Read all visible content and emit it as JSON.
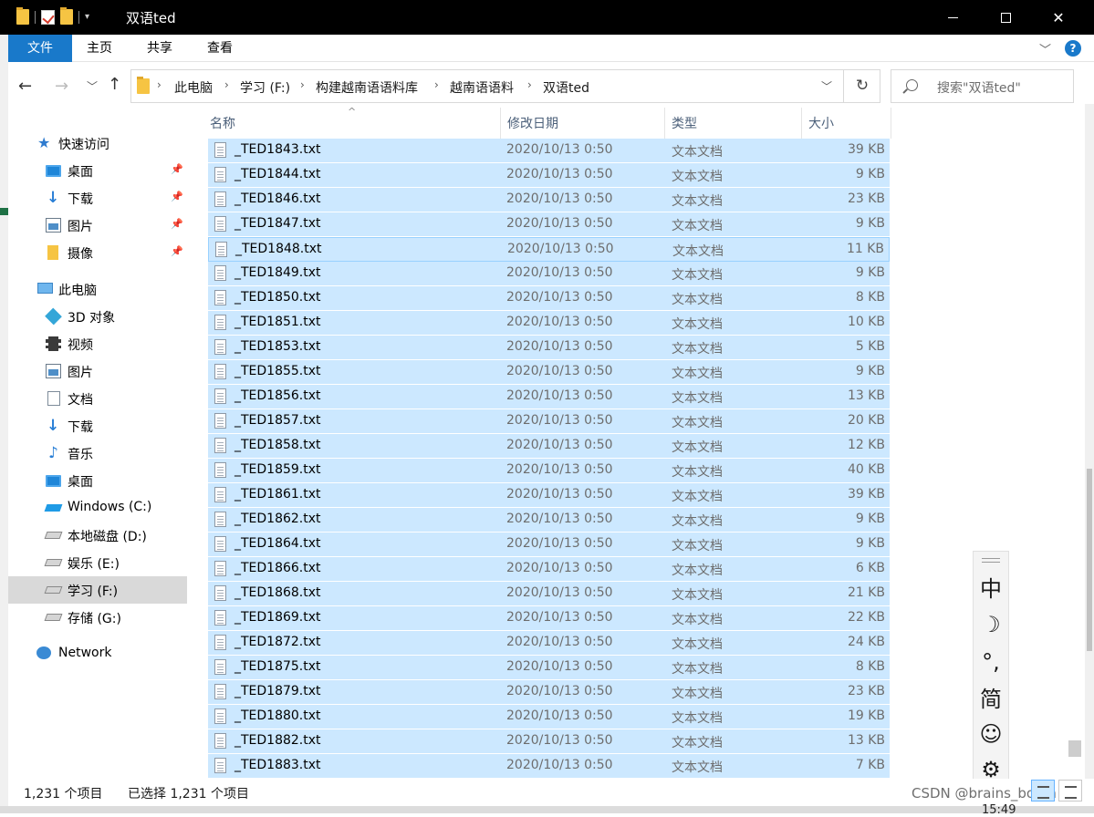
{
  "window": {
    "title": "双语ted",
    "minimize_glyph": "minimize-icon",
    "maximize_glyph": "maximize-icon",
    "close_glyph": "✕"
  },
  "ribbon": {
    "file": "文件",
    "home": "主页",
    "share": "共享",
    "view": "查看",
    "help": "?"
  },
  "address": {
    "crumbs": [
      "此电脑",
      "学习 (F:)",
      "构建越南语语料库",
      "越南语语料",
      "双语ted"
    ]
  },
  "search": {
    "placeholder": "搜索\"双语ted\""
  },
  "nav": {
    "quick_access": "快速访问",
    "quick_items": [
      {
        "label": "桌面",
        "icon": "desktop-icon"
      },
      {
        "label": "下载",
        "icon": "download-icon"
      },
      {
        "label": "图片",
        "icon": "pictures-icon"
      },
      {
        "label": "摄像",
        "icon": "folder-icon"
      }
    ],
    "this_pc": "此电脑",
    "pc_items": [
      {
        "label": "3D 对象",
        "icon": "3d-objects-icon"
      },
      {
        "label": "视频",
        "icon": "video-icon"
      },
      {
        "label": "图片",
        "icon": "pictures-icon"
      },
      {
        "label": "文档",
        "icon": "documents-icon"
      },
      {
        "label": "下载",
        "icon": "download-icon"
      },
      {
        "label": "音乐",
        "icon": "music-icon"
      },
      {
        "label": "桌面",
        "icon": "desktop-icon"
      },
      {
        "label": "Windows (C:)",
        "icon": "windows-drive-icon"
      },
      {
        "label": "本地磁盘 (D:)",
        "icon": "drive-icon"
      },
      {
        "label": "娱乐 (E:)",
        "icon": "drive-icon"
      },
      {
        "label": "学习 (F:)",
        "icon": "drive-icon"
      },
      {
        "label": "存储 (G:)",
        "icon": "drive-icon"
      }
    ],
    "selected": "学习 (F:)",
    "network": "Network"
  },
  "columns": {
    "name": "名称",
    "date": "修改日期",
    "type": "类型",
    "size": "大小"
  },
  "files": [
    {
      "name": "_TED1843.txt",
      "date": "2020/10/13 0:50",
      "type": "文本文档",
      "size": "39 KB"
    },
    {
      "name": "_TED1844.txt",
      "date": "2020/10/13 0:50",
      "type": "文本文档",
      "size": "9 KB"
    },
    {
      "name": "_TED1846.txt",
      "date": "2020/10/13 0:50",
      "type": "文本文档",
      "size": "23 KB"
    },
    {
      "name": "_TED1847.txt",
      "date": "2020/10/13 0:50",
      "type": "文本文档",
      "size": "9 KB"
    },
    {
      "name": "_TED1848.txt",
      "date": "2020/10/13 0:50",
      "type": "文本文档",
      "size": "11 KB"
    },
    {
      "name": "_TED1849.txt",
      "date": "2020/10/13 0:50",
      "type": "文本文档",
      "size": "9 KB"
    },
    {
      "name": "_TED1850.txt",
      "date": "2020/10/13 0:50",
      "type": "文本文档",
      "size": "8 KB"
    },
    {
      "name": "_TED1851.txt",
      "date": "2020/10/13 0:50",
      "type": "文本文档",
      "size": "10 KB"
    },
    {
      "name": "_TED1853.txt",
      "date": "2020/10/13 0:50",
      "type": "文本文档",
      "size": "5 KB"
    },
    {
      "name": "_TED1855.txt",
      "date": "2020/10/13 0:50",
      "type": "文本文档",
      "size": "9 KB"
    },
    {
      "name": "_TED1856.txt",
      "date": "2020/10/13 0:50",
      "type": "文本文档",
      "size": "13 KB"
    },
    {
      "name": "_TED1857.txt",
      "date": "2020/10/13 0:50",
      "type": "文本文档",
      "size": "20 KB"
    },
    {
      "name": "_TED1858.txt",
      "date": "2020/10/13 0:50",
      "type": "文本文档",
      "size": "12 KB"
    },
    {
      "name": "_TED1859.txt",
      "date": "2020/10/13 0:50",
      "type": "文本文档",
      "size": "40 KB"
    },
    {
      "name": "_TED1861.txt",
      "date": "2020/10/13 0:50",
      "type": "文本文档",
      "size": "39 KB"
    },
    {
      "name": "_TED1862.txt",
      "date": "2020/10/13 0:50",
      "type": "文本文档",
      "size": "9 KB"
    },
    {
      "name": "_TED1864.txt",
      "date": "2020/10/13 0:50",
      "type": "文本文档",
      "size": "9 KB"
    },
    {
      "name": "_TED1866.txt",
      "date": "2020/10/13 0:50",
      "type": "文本文档",
      "size": "6 KB"
    },
    {
      "name": "_TED1868.txt",
      "date": "2020/10/13 0:50",
      "type": "文本文档",
      "size": "21 KB"
    },
    {
      "name": "_TED1869.txt",
      "date": "2020/10/13 0:50",
      "type": "文本文档",
      "size": "22 KB"
    },
    {
      "name": "_TED1872.txt",
      "date": "2020/10/13 0:50",
      "type": "文本文档",
      "size": "24 KB"
    },
    {
      "name": "_TED1875.txt",
      "date": "2020/10/13 0:50",
      "type": "文本文档",
      "size": "8 KB"
    },
    {
      "name": "_TED1879.txt",
      "date": "2020/10/13 0:50",
      "type": "文本文档",
      "size": "23 KB"
    },
    {
      "name": "_TED1880.txt",
      "date": "2020/10/13 0:50",
      "type": "文本文档",
      "size": "19 KB"
    },
    {
      "name": "_TED1882.txt",
      "date": "2020/10/13 0:50",
      "type": "文本文档",
      "size": "13 KB"
    },
    {
      "name": "_TED1883.txt",
      "date": "2020/10/13 0:50",
      "type": "文本文档",
      "size": "7 KB"
    }
  ],
  "focused_file": "_TED1848.txt",
  "status": {
    "item_count": "1,231 个项目",
    "selected_count": "已选择 1,231 个项目"
  },
  "ime": {
    "mode": "中",
    "moon": "☽",
    "punct": "°,",
    "script": "简",
    "emoji": "☺",
    "settings": "⚙"
  },
  "watermark": "CSDN @brains_boom",
  "clock": "15:49",
  "colors": {
    "accent": "#1979ca",
    "selection": "#cce8ff",
    "selection_border": "#99d1ff"
  }
}
